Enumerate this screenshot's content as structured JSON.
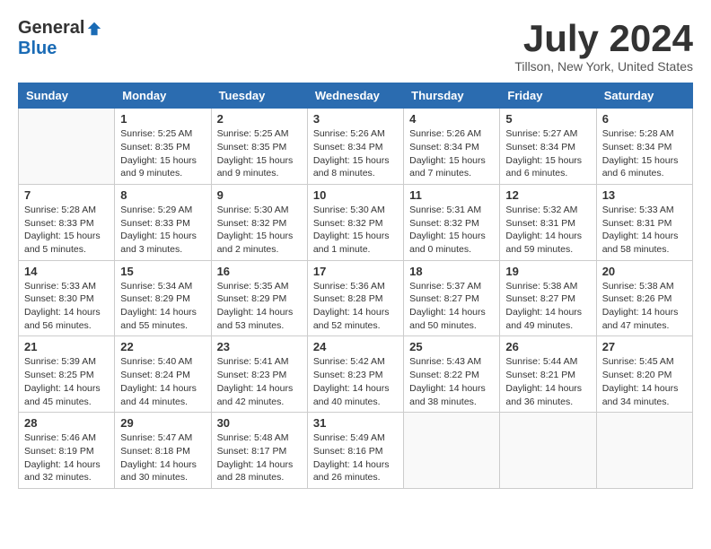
{
  "header": {
    "logo_general": "General",
    "logo_blue": "Blue",
    "month_title": "July 2024",
    "location": "Tillson, New York, United States"
  },
  "weekdays": [
    "Sunday",
    "Monday",
    "Tuesday",
    "Wednesday",
    "Thursday",
    "Friday",
    "Saturday"
  ],
  "weeks": [
    [
      {
        "day": "",
        "info": ""
      },
      {
        "day": "1",
        "info": "Sunrise: 5:25 AM\nSunset: 8:35 PM\nDaylight: 15 hours\nand 9 minutes."
      },
      {
        "day": "2",
        "info": "Sunrise: 5:25 AM\nSunset: 8:35 PM\nDaylight: 15 hours\nand 9 minutes."
      },
      {
        "day": "3",
        "info": "Sunrise: 5:26 AM\nSunset: 8:34 PM\nDaylight: 15 hours\nand 8 minutes."
      },
      {
        "day": "4",
        "info": "Sunrise: 5:26 AM\nSunset: 8:34 PM\nDaylight: 15 hours\nand 7 minutes."
      },
      {
        "day": "5",
        "info": "Sunrise: 5:27 AM\nSunset: 8:34 PM\nDaylight: 15 hours\nand 6 minutes."
      },
      {
        "day": "6",
        "info": "Sunrise: 5:28 AM\nSunset: 8:34 PM\nDaylight: 15 hours\nand 6 minutes."
      }
    ],
    [
      {
        "day": "7",
        "info": "Sunrise: 5:28 AM\nSunset: 8:33 PM\nDaylight: 15 hours\nand 5 minutes."
      },
      {
        "day": "8",
        "info": "Sunrise: 5:29 AM\nSunset: 8:33 PM\nDaylight: 15 hours\nand 3 minutes."
      },
      {
        "day": "9",
        "info": "Sunrise: 5:30 AM\nSunset: 8:32 PM\nDaylight: 15 hours\nand 2 minutes."
      },
      {
        "day": "10",
        "info": "Sunrise: 5:30 AM\nSunset: 8:32 PM\nDaylight: 15 hours\nand 1 minute."
      },
      {
        "day": "11",
        "info": "Sunrise: 5:31 AM\nSunset: 8:32 PM\nDaylight: 15 hours\nand 0 minutes."
      },
      {
        "day": "12",
        "info": "Sunrise: 5:32 AM\nSunset: 8:31 PM\nDaylight: 14 hours\nand 59 minutes."
      },
      {
        "day": "13",
        "info": "Sunrise: 5:33 AM\nSunset: 8:31 PM\nDaylight: 14 hours\nand 58 minutes."
      }
    ],
    [
      {
        "day": "14",
        "info": "Sunrise: 5:33 AM\nSunset: 8:30 PM\nDaylight: 14 hours\nand 56 minutes."
      },
      {
        "day": "15",
        "info": "Sunrise: 5:34 AM\nSunset: 8:29 PM\nDaylight: 14 hours\nand 55 minutes."
      },
      {
        "day": "16",
        "info": "Sunrise: 5:35 AM\nSunset: 8:29 PM\nDaylight: 14 hours\nand 53 minutes."
      },
      {
        "day": "17",
        "info": "Sunrise: 5:36 AM\nSunset: 8:28 PM\nDaylight: 14 hours\nand 52 minutes."
      },
      {
        "day": "18",
        "info": "Sunrise: 5:37 AM\nSunset: 8:27 PM\nDaylight: 14 hours\nand 50 minutes."
      },
      {
        "day": "19",
        "info": "Sunrise: 5:38 AM\nSunset: 8:27 PM\nDaylight: 14 hours\nand 49 minutes."
      },
      {
        "day": "20",
        "info": "Sunrise: 5:38 AM\nSunset: 8:26 PM\nDaylight: 14 hours\nand 47 minutes."
      }
    ],
    [
      {
        "day": "21",
        "info": "Sunrise: 5:39 AM\nSunset: 8:25 PM\nDaylight: 14 hours\nand 45 minutes."
      },
      {
        "day": "22",
        "info": "Sunrise: 5:40 AM\nSunset: 8:24 PM\nDaylight: 14 hours\nand 44 minutes."
      },
      {
        "day": "23",
        "info": "Sunrise: 5:41 AM\nSunset: 8:23 PM\nDaylight: 14 hours\nand 42 minutes."
      },
      {
        "day": "24",
        "info": "Sunrise: 5:42 AM\nSunset: 8:23 PM\nDaylight: 14 hours\nand 40 minutes."
      },
      {
        "day": "25",
        "info": "Sunrise: 5:43 AM\nSunset: 8:22 PM\nDaylight: 14 hours\nand 38 minutes."
      },
      {
        "day": "26",
        "info": "Sunrise: 5:44 AM\nSunset: 8:21 PM\nDaylight: 14 hours\nand 36 minutes."
      },
      {
        "day": "27",
        "info": "Sunrise: 5:45 AM\nSunset: 8:20 PM\nDaylight: 14 hours\nand 34 minutes."
      }
    ],
    [
      {
        "day": "28",
        "info": "Sunrise: 5:46 AM\nSunset: 8:19 PM\nDaylight: 14 hours\nand 32 minutes."
      },
      {
        "day": "29",
        "info": "Sunrise: 5:47 AM\nSunset: 8:18 PM\nDaylight: 14 hours\nand 30 minutes."
      },
      {
        "day": "30",
        "info": "Sunrise: 5:48 AM\nSunset: 8:17 PM\nDaylight: 14 hours\nand 28 minutes."
      },
      {
        "day": "31",
        "info": "Sunrise: 5:49 AM\nSunset: 8:16 PM\nDaylight: 14 hours\nand 26 minutes."
      },
      {
        "day": "",
        "info": ""
      },
      {
        "day": "",
        "info": ""
      },
      {
        "day": "",
        "info": ""
      }
    ]
  ]
}
